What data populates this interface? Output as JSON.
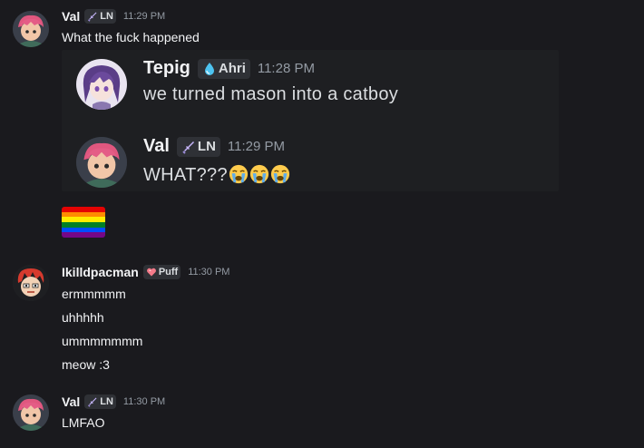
{
  "messages": [
    {
      "author": "Val",
      "tag": "LN",
      "time": "11:29 PM",
      "text": "What the fuck happened"
    },
    {
      "author": "Ikilldpacman",
      "tag": "Puff",
      "time": "11:30 PM",
      "lines": [
        "ermmmmm",
        "uhhhhh",
        "ummmmmmm",
        "meow :3"
      ]
    },
    {
      "author": "Val",
      "tag": "LN",
      "time": "11:30 PM",
      "text": "LMFAO"
    }
  ],
  "embed": {
    "first": {
      "author": "Tepig",
      "tag": "Ahri",
      "time": "11:28 PM",
      "text": "we turned mason into a catboy"
    },
    "second": {
      "author": "Val",
      "tag": "LN",
      "time": "11:29 PM",
      "text": "WHAT???",
      "emojis": [
        "loudly-crying-face",
        "loudly-crying-face",
        "loudly-crying-face"
      ]
    }
  },
  "attachment": {
    "type": "pride-flag-emoji",
    "colors": [
      "#e40303",
      "#ff8c00",
      "#ffed00",
      "#008026",
      "#004dff",
      "#750787"
    ]
  },
  "colors": {
    "background": "#1a1a1e",
    "name": "#f2f3f5",
    "timestamp": "#949ba4",
    "tag_bg": "#2f3136"
  }
}
